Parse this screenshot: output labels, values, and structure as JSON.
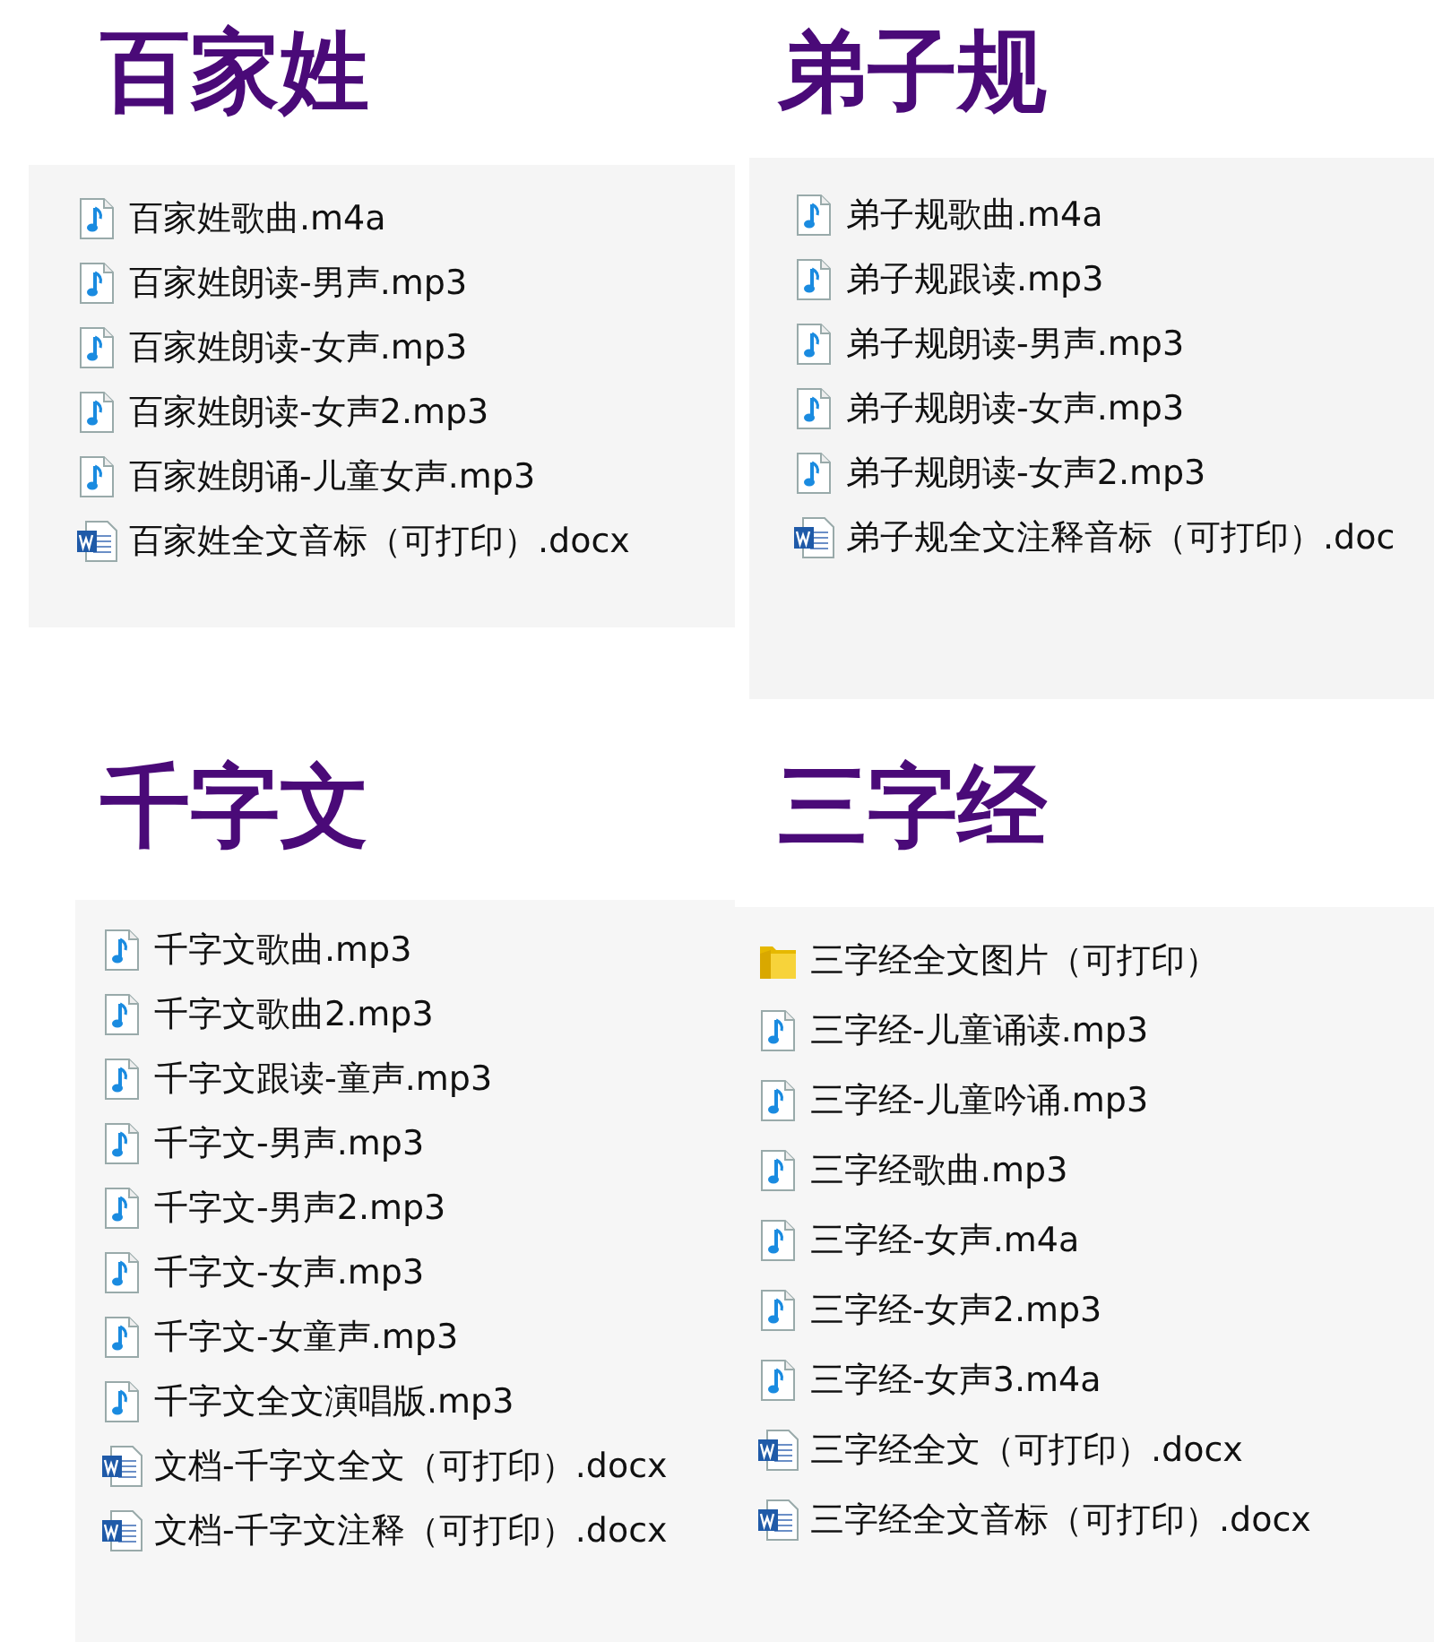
{
  "sections": [
    {
      "title": "百家姓",
      "files": [
        {
          "name": "百家姓歌曲.m4a",
          "kind": "audio"
        },
        {
          "name": "百家姓朗读-男声.mp3",
          "kind": "audio"
        },
        {
          "name": "百家姓朗读-女声.mp3",
          "kind": "audio"
        },
        {
          "name": "百家姓朗读-女声2.mp3",
          "kind": "audio"
        },
        {
          "name": "百家姓朗诵-儿童女声.mp3",
          "kind": "audio"
        },
        {
          "name": "百家姓全文音标（可打印）.docx",
          "kind": "word"
        }
      ]
    },
    {
      "title": "弟子规",
      "files": [
        {
          "name": "弟子规歌曲.m4a",
          "kind": "audio"
        },
        {
          "name": "弟子规跟读.mp3",
          "kind": "audio"
        },
        {
          "name": "弟子规朗读-男声.mp3",
          "kind": "audio"
        },
        {
          "name": "弟子规朗读-女声.mp3",
          "kind": "audio"
        },
        {
          "name": "弟子规朗读-女声2.mp3",
          "kind": "audio"
        },
        {
          "name": "弟子规全文注释音标（可打印）.doc",
          "kind": "word"
        }
      ]
    },
    {
      "title": "千字文",
      "files": [
        {
          "name": "千字文歌曲.mp3",
          "kind": "audio"
        },
        {
          "name": "千字文歌曲2.mp3",
          "kind": "audio"
        },
        {
          "name": "千字文跟读-童声.mp3",
          "kind": "audio"
        },
        {
          "name": "千字文-男声.mp3",
          "kind": "audio"
        },
        {
          "name": "千字文-男声2.mp3",
          "kind": "audio"
        },
        {
          "name": "千字文-女声.mp3",
          "kind": "audio"
        },
        {
          "name": "千字文-女童声.mp3",
          "kind": "audio"
        },
        {
          "name": "千字文全文演唱版.mp3",
          "kind": "audio"
        },
        {
          "name": "文档-千字文全文（可打印）.docx",
          "kind": "word"
        },
        {
          "name": "文档-千字文注释（可打印）.docx",
          "kind": "word"
        }
      ]
    },
    {
      "title": "三字经",
      "files": [
        {
          "name": "三字经全文图片（可打印）",
          "kind": "folder"
        },
        {
          "name": "三字经-儿童诵读.mp3",
          "kind": "audio"
        },
        {
          "name": "三字经-儿童吟诵.mp3",
          "kind": "audio"
        },
        {
          "name": "三字经歌曲.mp3",
          "kind": "audio"
        },
        {
          "name": "三字经-女声.m4a",
          "kind": "audio"
        },
        {
          "name": "三字经-女声2.mp3",
          "kind": "audio"
        },
        {
          "name": "三字经-女声3.m4a",
          "kind": "audio"
        },
        {
          "name": "三字经全文（可打印）.docx",
          "kind": "word"
        },
        {
          "name": "三字经全文音标（可打印）.docx",
          "kind": "word"
        }
      ]
    }
  ]
}
